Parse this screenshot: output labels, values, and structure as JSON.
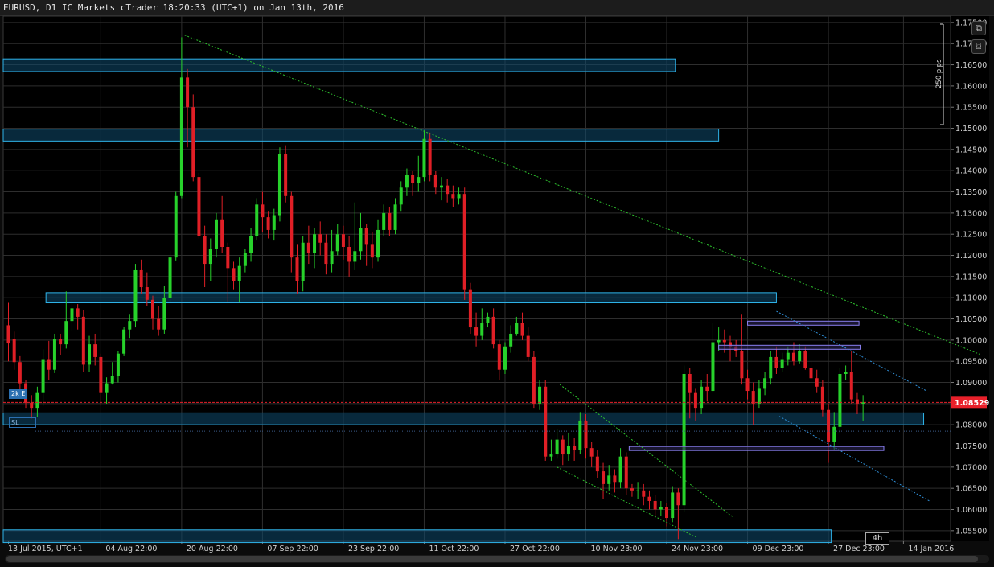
{
  "window": {
    "title": "EURUSD, D1 IC Markets cTrader 18:20:33 (UTC+1) on Jan 13th, 2016"
  },
  "toolbar": {
    "detach_icon": "external-link-icon",
    "screenshot_icon": "camera-icon"
  },
  "ruler": {
    "label": "250 pips"
  },
  "current_price": {
    "label": "1.08529",
    "value": 1.08529,
    "color": "#e8202a"
  },
  "position_tags": {
    "tp": "2k E",
    "sl": "SL"
  },
  "timeframe_badge": "4h",
  "colors": {
    "bull": "#27d22b",
    "bear": "#e01f26",
    "zone_fill": "#0e4a6e",
    "zone_stroke": "#2fb4ea",
    "trend_green": "#2ec02e",
    "trend_blue": "#2f8fd8",
    "range_stroke": "#8a7ff0",
    "grid": "#2e2e2e"
  },
  "chart_data": {
    "type": "candlestick",
    "symbol": "EURUSD",
    "timeframe": "D1",
    "y_axis": {
      "ticks": [
        "1.17500",
        "1.17000",
        "1.16500",
        "1.16000",
        "1.15500",
        "1.15000",
        "1.14500",
        "1.14000",
        "1.13500",
        "1.13000",
        "1.12500",
        "1.12000",
        "1.11500",
        "1.11000",
        "1.10500",
        "1.10000",
        "1.09500",
        "1.09000",
        "1.08500",
        "1.08000",
        "1.07500",
        "1.07000",
        "1.06500",
        "1.06000",
        "1.05500"
      ],
      "range": [
        1.0525,
        1.1765
      ]
    },
    "x_axis": {
      "labels": [
        "13 Jul 2015, UTC+1",
        "04 Aug 22:00",
        "20 Aug 22:00",
        "07 Sep 22:00",
        "23 Sep 22:00",
        "11 Oct 22:00",
        "27 Oct 22:00",
        "10 Nov 23:00",
        "24 Nov 23:00",
        "09 Dec 23:00",
        "27 Dec 23:00",
        "14 Jan 2016"
      ],
      "label_index": [
        0,
        16,
        30,
        44,
        58,
        72,
        86,
        100,
        114,
        128,
        142,
        155
      ]
    },
    "candles": [
      [
        1.1035,
        1.0992,
        1.1088,
        1.095
      ],
      [
        1.1002,
        1.0948,
        1.102,
        1.093
      ],
      [
        1.0948,
        1.0898,
        1.0962,
        1.0875
      ],
      [
        1.0898,
        1.0852,
        1.0905,
        1.084
      ],
      [
        1.0852,
        1.084,
        1.087,
        1.0815
      ],
      [
        1.084,
        1.0875,
        1.089,
        1.0818
      ],
      [
        1.0875,
        1.0955,
        1.0978,
        1.0845
      ],
      [
        1.0955,
        1.093,
        1.0998,
        1.0905
      ],
      [
        1.093,
        1.1002,
        1.1015,
        1.0922
      ],
      [
        1.1002,
        1.099,
        1.1015,
        1.0965
      ],
      [
        1.099,
        1.1045,
        1.1115,
        1.098
      ],
      [
        1.1045,
        1.1075,
        1.1095,
        1.102
      ],
      [
        1.1075,
        1.1055,
        1.1085,
        1.1025
      ],
      [
        1.1055,
        1.0942,
        1.107,
        1.0925
      ],
      [
        1.0942,
        1.099,
        1.101,
        1.0925
      ],
      [
        1.099,
        1.096,
        1.1015,
        1.094
      ],
      [
        1.096,
        1.0875,
        1.0968,
        1.0845
      ],
      [
        1.0875,
        1.0898,
        1.0912,
        1.085
      ],
      [
        1.0898,
        1.0915,
        1.0948,
        1.0895
      ],
      [
        1.0915,
        1.0968,
        1.0975,
        1.09
      ],
      [
        1.0968,
        1.1025,
        1.1032,
        1.0962
      ],
      [
        1.1025,
        1.1045,
        1.106,
        1.1005
      ],
      [
        1.1045,
        1.1165,
        1.118,
        1.103
      ],
      [
        1.1165,
        1.1125,
        1.119,
        1.111
      ],
      [
        1.1125,
        1.1095,
        1.116,
        1.108
      ],
      [
        1.1095,
        1.105,
        1.1105,
        1.1025
      ],
      [
        1.105,
        1.1025,
        1.108,
        1.101
      ],
      [
        1.1025,
        1.11,
        1.1128,
        1.1015
      ],
      [
        1.11,
        1.1195,
        1.121,
        1.109
      ],
      [
        1.1195,
        1.134,
        1.135,
        1.1188
      ],
      [
        1.134,
        1.162,
        1.1715,
        1.1335
      ],
      [
        1.162,
        1.155,
        1.164,
        1.1455
      ],
      [
        1.155,
        1.1385,
        1.158,
        1.1375
      ],
      [
        1.1385,
        1.1245,
        1.1395,
        1.124
      ],
      [
        1.1245,
        1.118,
        1.127,
        1.1125
      ],
      [
        1.118,
        1.1215,
        1.124,
        1.114
      ],
      [
        1.1215,
        1.1285,
        1.13,
        1.1195
      ],
      [
        1.1285,
        1.122,
        1.134,
        1.1205
      ],
      [
        1.122,
        1.117,
        1.123,
        1.109
      ],
      [
        1.117,
        1.114,
        1.1185,
        1.112
      ],
      [
        1.114,
        1.1175,
        1.1195,
        1.109
      ],
      [
        1.1175,
        1.1205,
        1.1215,
        1.116
      ],
      [
        1.1205,
        1.1245,
        1.1265,
        1.1185
      ],
      [
        1.1245,
        1.132,
        1.1335,
        1.1235
      ],
      [
        1.132,
        1.129,
        1.135,
        1.1255
      ],
      [
        1.129,
        1.126,
        1.1305,
        1.124
      ],
      [
        1.126,
        1.1295,
        1.131,
        1.1235
      ],
      [
        1.1295,
        1.144,
        1.1455,
        1.128
      ],
      [
        1.144,
        1.134,
        1.146,
        1.1325
      ],
      [
        1.134,
        1.1195,
        1.135,
        1.116
      ],
      [
        1.1195,
        1.114,
        1.1225,
        1.111
      ],
      [
        1.114,
        1.123,
        1.1245,
        1.1115
      ],
      [
        1.123,
        1.1205,
        1.127,
        1.118
      ],
      [
        1.1205,
        1.125,
        1.1265,
        1.117
      ],
      [
        1.125,
        1.123,
        1.128,
        1.12
      ],
      [
        1.123,
        1.118,
        1.125,
        1.1155
      ],
      [
        1.118,
        1.121,
        1.126,
        1.116
      ],
      [
        1.121,
        1.125,
        1.1275,
        1.12
      ],
      [
        1.125,
        1.122,
        1.127,
        1.119
      ],
      [
        1.122,
        1.1185,
        1.1245,
        1.115
      ],
      [
        1.1185,
        1.121,
        1.1325,
        1.1165
      ],
      [
        1.121,
        1.1265,
        1.13,
        1.119
      ],
      [
        1.1265,
        1.1225,
        1.1275,
        1.1175
      ],
      [
        1.1225,
        1.1195,
        1.1255,
        1.117
      ],
      [
        1.1195,
        1.126,
        1.1285,
        1.1185
      ],
      [
        1.126,
        1.13,
        1.132,
        1.1245
      ],
      [
        1.13,
        1.126,
        1.1315,
        1.1245
      ],
      [
        1.126,
        1.132,
        1.1335,
        1.125
      ],
      [
        1.132,
        1.136,
        1.1375,
        1.1305
      ],
      [
        1.136,
        1.139,
        1.1405,
        1.134
      ],
      [
        1.139,
        1.137,
        1.14,
        1.134
      ],
      [
        1.137,
        1.1385,
        1.1435,
        1.135
      ],
      [
        1.1385,
        1.1475,
        1.1495,
        1.1375
      ],
      [
        1.1475,
        1.139,
        1.149,
        1.1375
      ],
      [
        1.139,
        1.136,
        1.14,
        1.1345
      ],
      [
        1.136,
        1.1365,
        1.1385,
        1.133
      ],
      [
        1.1365,
        1.1345,
        1.138,
        1.1325
      ],
      [
        1.1345,
        1.1335,
        1.1365,
        1.1315
      ],
      [
        1.1335,
        1.1345,
        1.136,
        1.132
      ],
      [
        1.1345,
        1.112,
        1.136,
        1.1095
      ],
      [
        1.112,
        1.103,
        1.1135,
        1.1015
      ],
      [
        1.103,
        1.101,
        1.1065,
        1.0985
      ],
      [
        1.101,
        1.104,
        1.1075,
        1.1
      ],
      [
        1.104,
        1.1055,
        1.1065,
        1.103
      ],
      [
        1.1055,
        1.099,
        1.1075,
        1.098
      ],
      [
        1.099,
        1.093,
        1.1,
        1.0905
      ],
      [
        1.093,
        1.0985,
        1.0995,
        1.092
      ],
      [
        1.0985,
        1.1015,
        1.1035,
        1.097
      ],
      [
        1.1015,
        1.104,
        1.1055,
        1.101
      ],
      [
        1.104,
        1.101,
        1.1065,
        1.1
      ],
      [
        1.101,
        1.096,
        1.103,
        1.095
      ],
      [
        1.096,
        1.085,
        1.0975,
        1.084
      ],
      [
        1.085,
        1.089,
        1.0905,
        1.0835
      ],
      [
        1.089,
        1.0725,
        1.0905,
        1.0715
      ],
      [
        1.0725,
        1.073,
        1.0765,
        1.0715
      ],
      [
        1.073,
        1.0765,
        1.079,
        1.072
      ],
      [
        1.0765,
        1.073,
        1.0775,
        1.0705
      ],
      [
        1.073,
        1.075,
        1.078,
        1.0715
      ],
      [
        1.075,
        1.074,
        1.077,
        1.0715
      ],
      [
        1.074,
        1.081,
        1.083,
        1.073
      ],
      [
        1.081,
        1.0745,
        1.0825,
        1.072
      ],
      [
        1.0745,
        1.0725,
        1.076,
        1.07
      ],
      [
        1.0725,
        1.069,
        1.074,
        1.0675
      ],
      [
        1.069,
        1.066,
        1.071,
        1.0625
      ],
      [
        1.066,
        1.068,
        1.0705,
        1.0645
      ],
      [
        1.068,
        1.0665,
        1.0695,
        1.064
      ],
      [
        1.0665,
        1.0725,
        1.0745,
        1.065
      ],
      [
        1.0725,
        1.065,
        1.0735,
        1.0635
      ],
      [
        1.065,
        1.0645,
        1.066,
        1.063
      ],
      [
        1.0645,
        1.0645,
        1.0665,
        1.0625
      ],
      [
        1.0645,
        1.063,
        1.066,
        1.061
      ],
      [
        1.063,
        1.062,
        1.0645,
        1.06
      ],
      [
        1.062,
        1.06,
        1.0635,
        1.0585
      ],
      [
        1.06,
        1.0605,
        1.062,
        1.0585
      ],
      [
        1.0605,
        1.058,
        1.0615,
        1.056
      ],
      [
        1.058,
        1.064,
        1.0655,
        1.057
      ],
      [
        1.064,
        1.061,
        1.065,
        1.053
      ],
      [
        1.061,
        1.092,
        1.094,
        1.0595
      ],
      [
        1.092,
        1.0875,
        1.0935,
        1.0815
      ],
      [
        1.0875,
        1.084,
        1.0885,
        1.081
      ],
      [
        1.084,
        1.089,
        1.0905,
        1.0825
      ],
      [
        1.089,
        1.088,
        1.092,
        1.0855
      ],
      [
        1.088,
        1.0995,
        1.104,
        1.0875
      ],
      [
        1.0995,
        1.1,
        1.103,
        1.0975
      ],
      [
        1.1,
        1.0995,
        1.1025,
        1.097
      ],
      [
        1.0995,
        1.0985,
        1.101,
        1.095
      ],
      [
        1.0985,
        1.0975,
        1.1,
        1.096
      ],
      [
        1.0975,
        1.091,
        1.106,
        1.0895
      ],
      [
        1.091,
        1.088,
        1.093,
        1.086
      ],
      [
        1.088,
        1.085,
        1.09,
        1.08
      ],
      [
        1.085,
        1.0885,
        1.0905,
        1.084
      ],
      [
        1.0885,
        1.091,
        1.0925,
        1.087
      ],
      [
        1.091,
        1.096,
        1.0975,
        1.0895
      ],
      [
        1.096,
        1.0935,
        1.0985,
        1.092
      ],
      [
        1.0935,
        1.0955,
        1.097,
        1.0925
      ],
      [
        1.0955,
        1.097,
        1.0985,
        1.094
      ],
      [
        1.097,
        1.095,
        1.0995,
        1.094
      ],
      [
        1.095,
        1.0975,
        1.099,
        1.0945
      ],
      [
        1.0975,
        1.0935,
        1.0985,
        1.093
      ],
      [
        1.0935,
        1.091,
        1.095,
        1.09
      ],
      [
        1.091,
        1.089,
        1.093,
        1.0875
      ],
      [
        1.089,
        1.0835,
        1.0905,
        1.082
      ],
      [
        1.0835,
        1.076,
        1.085,
        1.071
      ],
      [
        1.076,
        1.0795,
        1.083,
        1.074
      ],
      [
        1.0795,
        1.092,
        1.0935,
        1.078
      ],
      [
        1.092,
        1.0925,
        1.094,
        1.0905
      ],
      [
        1.0925,
        1.086,
        1.0975,
        1.085
      ],
      [
        1.086,
        1.085,
        1.0875,
        1.0825
      ],
      [
        1.085,
        1.0853,
        1.087,
        1.081
      ]
    ],
    "zones": [
      {
        "y1": 1.1664,
        "y2": 1.1634,
        "i1": -1.0,
        "i2": 115.5
      },
      {
        "y1": 1.1498,
        "y2": 1.147,
        "i1": -1.0,
        "i2": 123.0
      },
      {
        "y1": 1.1112,
        "y2": 1.1088,
        "i1": 6.5,
        "i2": 133.0
      },
      {
        "y1": 1.0828,
        "y2": 1.08,
        "i1": -1.0,
        "i2": 158.5
      },
      {
        "y1": 1.0552,
        "y2": 1.0522,
        "i1": -1.0,
        "i2": 142.5
      }
    ],
    "ranges": [
      {
        "y": 1.104,
        "i1": 128.0,
        "i2": 147.3
      },
      {
        "y": 1.0983,
        "i1": 123.0,
        "i2": 147.5
      },
      {
        "y": 1.0744,
        "i1": 107.5,
        "i2": 151.6
      }
    ],
    "trendlines": [
      {
        "i1": 30.5,
        "x1v": 1.172,
        "i2": 168.5,
        "x2v": 1.0965,
        "style": "green"
      },
      {
        "i1": 95.5,
        "x1v": 1.0895,
        "i2": 125.5,
        "x2v": 1.0582,
        "style": "green"
      },
      {
        "i1": 95.0,
        "x1v": 1.07,
        "i2": 119.0,
        "x2v": 1.0535,
        "style": "green"
      },
      {
        "i1": 133.0,
        "x1v": 1.1068,
        "i2": 159.0,
        "x2v": 1.088,
        "style": "blue"
      },
      {
        "i1": 133.5,
        "x1v": 1.082,
        "i2": 159.5,
        "x2v": 1.062,
        "style": "blue"
      }
    ],
    "sl_level": 1.0785,
    "grid": true
  }
}
